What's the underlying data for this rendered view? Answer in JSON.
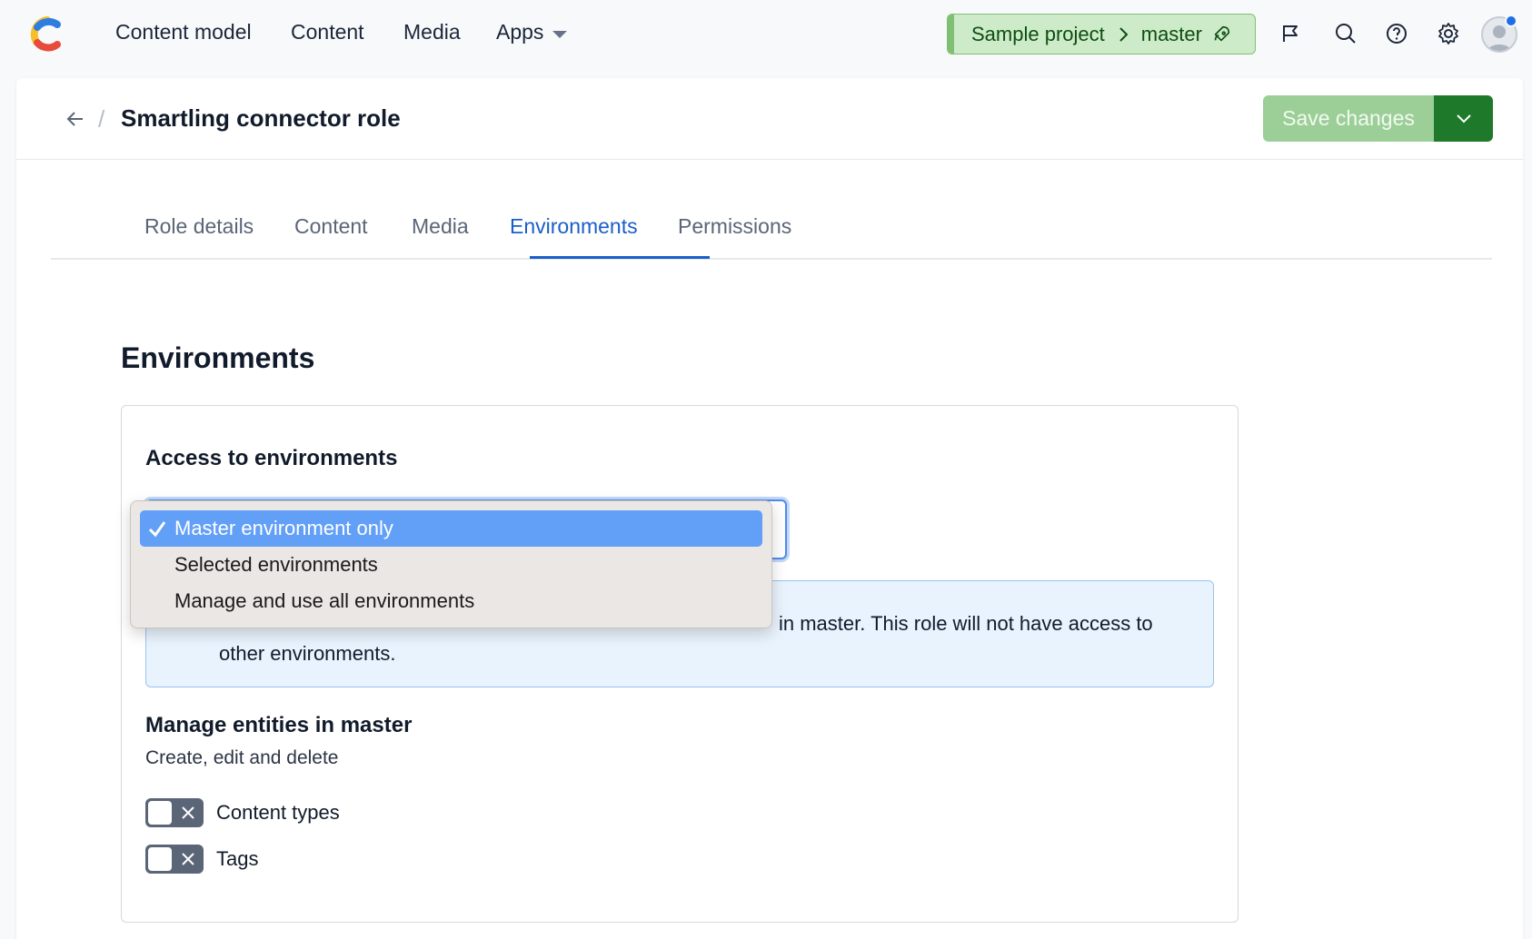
{
  "nav": {
    "items": [
      "Content model",
      "Content",
      "Media",
      "Apps"
    ],
    "space": "Sample project",
    "environment": "master"
  },
  "header": {
    "title": "Smartling connector role",
    "save_label": "Save changes"
  },
  "tabs": [
    "Role details",
    "Content",
    "Media",
    "Environments",
    "Permissions"
  ],
  "active_tab": "Environments",
  "section": {
    "title": "Environments",
    "access_heading": "Access to environments",
    "info_text_visible": "in master. This role will not have access to",
    "info_text_line2": "other environments.",
    "manage_heading": "Manage entities in master",
    "manage_desc": "Create, edit and delete",
    "toggles": [
      {
        "label": "Content types",
        "checked": false
      },
      {
        "label": "Tags",
        "checked": false
      }
    ]
  },
  "dropdown": {
    "options": [
      "Master environment only",
      "Selected environments",
      "Manage and use all environments"
    ],
    "selected_index": 0
  },
  "colors": {
    "accent": "#1a5fc8",
    "env_pill_bg": "#cdebc8",
    "save_bg": "#9ccf97",
    "save_caret_bg": "#1e7a2a",
    "selected_option": "#629ff7"
  }
}
